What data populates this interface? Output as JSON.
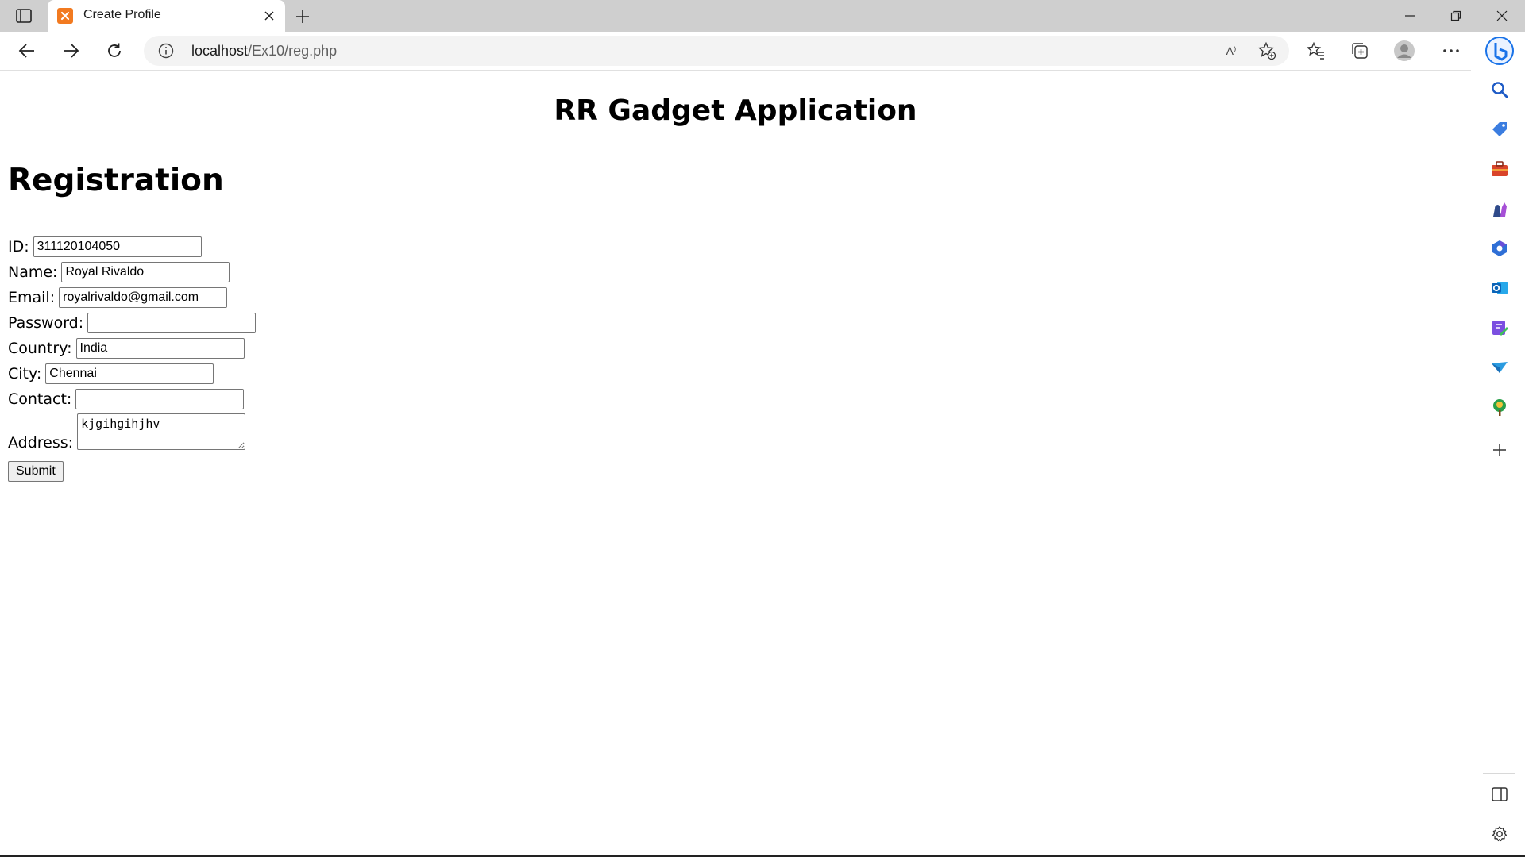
{
  "browser": {
    "tab": {
      "title": "Create Profile"
    },
    "address": {
      "host": "localhost",
      "path": "/Ex10/reg.php"
    },
    "read_aloud_label": "A⁾"
  },
  "page": {
    "heading": "RR Gadget Application",
    "form_title": "Registration",
    "fields": {
      "id": {
        "label": "ID:",
        "value": "311120104050"
      },
      "name": {
        "label": "Name:",
        "value": "Royal Rivaldo"
      },
      "email": {
        "label": "Email:",
        "value": "royalrivaldo@gmail.com"
      },
      "password": {
        "label": "Password:",
        "value": ""
      },
      "country": {
        "label": "Country:",
        "value": "India"
      },
      "city": {
        "label": "City:",
        "value": "Chennai"
      },
      "contact": {
        "label": "Contact:",
        "value": ""
      },
      "address": {
        "label": "Address:",
        "value": "kjgihgihjhv"
      }
    },
    "submit_label": "Submit"
  },
  "colors": {
    "titlebar": "#cfcfcf",
    "favicon": "#f27a20",
    "address_bar": "#f3f3f3",
    "bing_blue": "#1a73e8"
  },
  "icons": {
    "sidebar": [
      "bing-copilot-icon",
      "search-icon",
      "shopping-tag-icon",
      "tools-briefcase-icon",
      "games-icon",
      "microsoft-365-icon",
      "outlook-icon",
      "designer-icon",
      "send-icon",
      "tree-icon",
      "add-icon",
      "sidebar-toggle-icon",
      "settings-icon"
    ]
  }
}
